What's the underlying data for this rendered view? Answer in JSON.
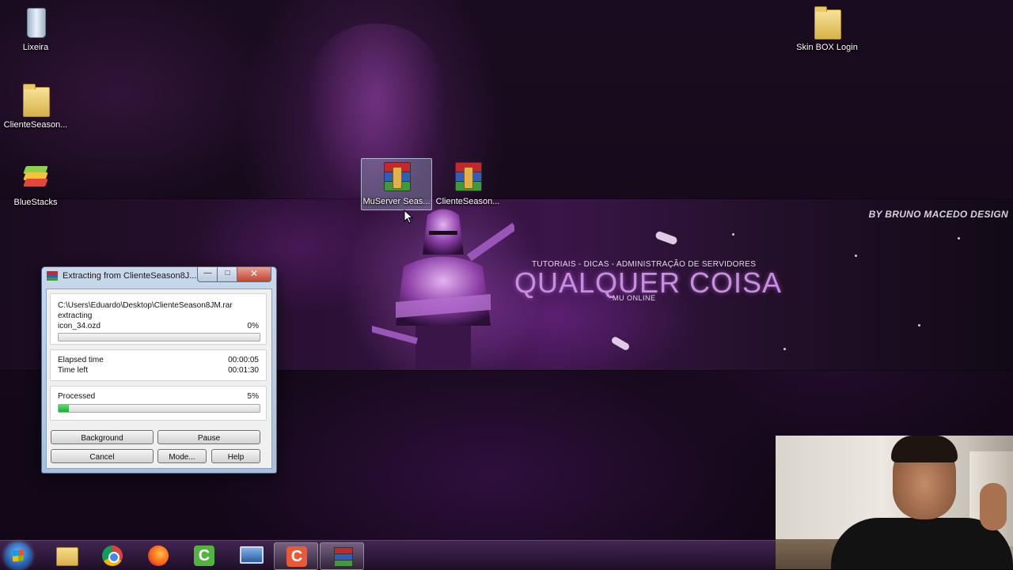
{
  "desktop": {
    "banner": {
      "credit": "BY BRUNO MACEDO DESIGN",
      "subtitle": "TUTORIAIS - DICAS - ADMINISTRAÇÃO DE SERVIDORES",
      "title": "QUALQUER COISA",
      "tagline": "MU ONLINE"
    },
    "icons": [
      {
        "label": "Lixeira",
        "icon": "recycle-bin-icon"
      },
      {
        "label": "ClienteSeason...",
        "icon": "folder-icon"
      },
      {
        "label": "BlueStacks",
        "icon": "bluestacks-icon"
      },
      {
        "label": "MuServer Seas...",
        "icon": "winrar-archive-icon",
        "selected": true
      },
      {
        "label": "ClienteSeason...",
        "icon": "winrar-archive-icon"
      },
      {
        "label": "Skin BOX Login",
        "icon": "folder-icon"
      }
    ]
  },
  "dialog": {
    "title": "Extracting from ClienteSeason8J...",
    "archive_path": "C:\\Users\\Eduardo\\Desktop\\ClienteSeason8JM.rar",
    "status": "extracting",
    "current_file": "icon_34.ozd",
    "current_percent": "0%",
    "current_progress": 0.0,
    "elapsed_label": "Elapsed time",
    "elapsed_value": "00:00:05",
    "left_label": "Time left",
    "left_value": "00:01:30",
    "processed_label": "Processed",
    "processed_percent": "5%",
    "processed_progress": 0.05,
    "buttons": {
      "background": "Background",
      "pause": "Pause",
      "cancel": "Cancel",
      "mode": "Mode...",
      "help": "Help"
    },
    "window_controls": {
      "minimize": "—",
      "maximize": "□",
      "close": "✕"
    }
  },
  "taskbar": {
    "items": [
      {
        "icon": "file-explorer-icon"
      },
      {
        "icon": "chrome-icon"
      },
      {
        "icon": "firefox-icon"
      },
      {
        "icon": "camtasia-icon"
      },
      {
        "icon": "remote-desktop-icon"
      },
      {
        "icon": "camtasia-recorder-icon"
      },
      {
        "icon": "winrar-icon",
        "active": true
      }
    ]
  },
  "colors": {
    "accent_purple": "#c98de0",
    "progress_green": "#1fa832"
  }
}
